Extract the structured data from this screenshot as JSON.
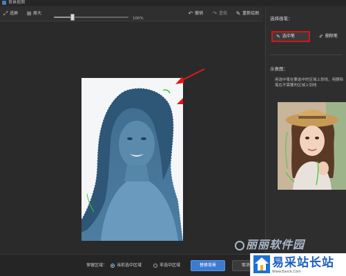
{
  "window": {
    "title": "背景抠图"
  },
  "toolbar": {
    "fit_label": "适屏",
    "original_label": "原大",
    "zoom_percent": 100,
    "zoom_text": "100%",
    "undo_label": "撤销",
    "redo_label": "重做",
    "redraw_label": "重新绘图"
  },
  "panel": {
    "choose_pen_heading": "选择画笔：",
    "select_pen_label": "选中笔",
    "delete_pen_label": "删除笔",
    "example_heading": "示意图：",
    "hint_text": "用选中笔在要选中的区域上划线，用删除笔在不需要的区域上划线"
  },
  "bottom": {
    "keep_area_label": "保留区域：",
    "options": [
      {
        "label": "当前选中区域",
        "selected": true
      },
      {
        "label": "非选中区域",
        "selected": false
      }
    ],
    "replace_bg_label": "替换背景",
    "cancel_label": "取消"
  },
  "watermarks": {
    "brand_text": "丽丽软件园",
    "site_name": "易采站长站",
    "site_url": "Www.Easck.Com"
  },
  "colors": {
    "accent_blue": "#3c7bd3",
    "highlight_red": "#d6161a",
    "stroke_green": "#36c93a",
    "arrow_red": "#e01818"
  },
  "icons": {
    "fit": "fit-screen-icon",
    "original": "original-size-icon",
    "undo": "undo-icon",
    "redo": "redo-icon",
    "redraw": "redraw-icon",
    "select_pen": "pen-icon",
    "delete_pen": "eraser-pen-icon"
  }
}
